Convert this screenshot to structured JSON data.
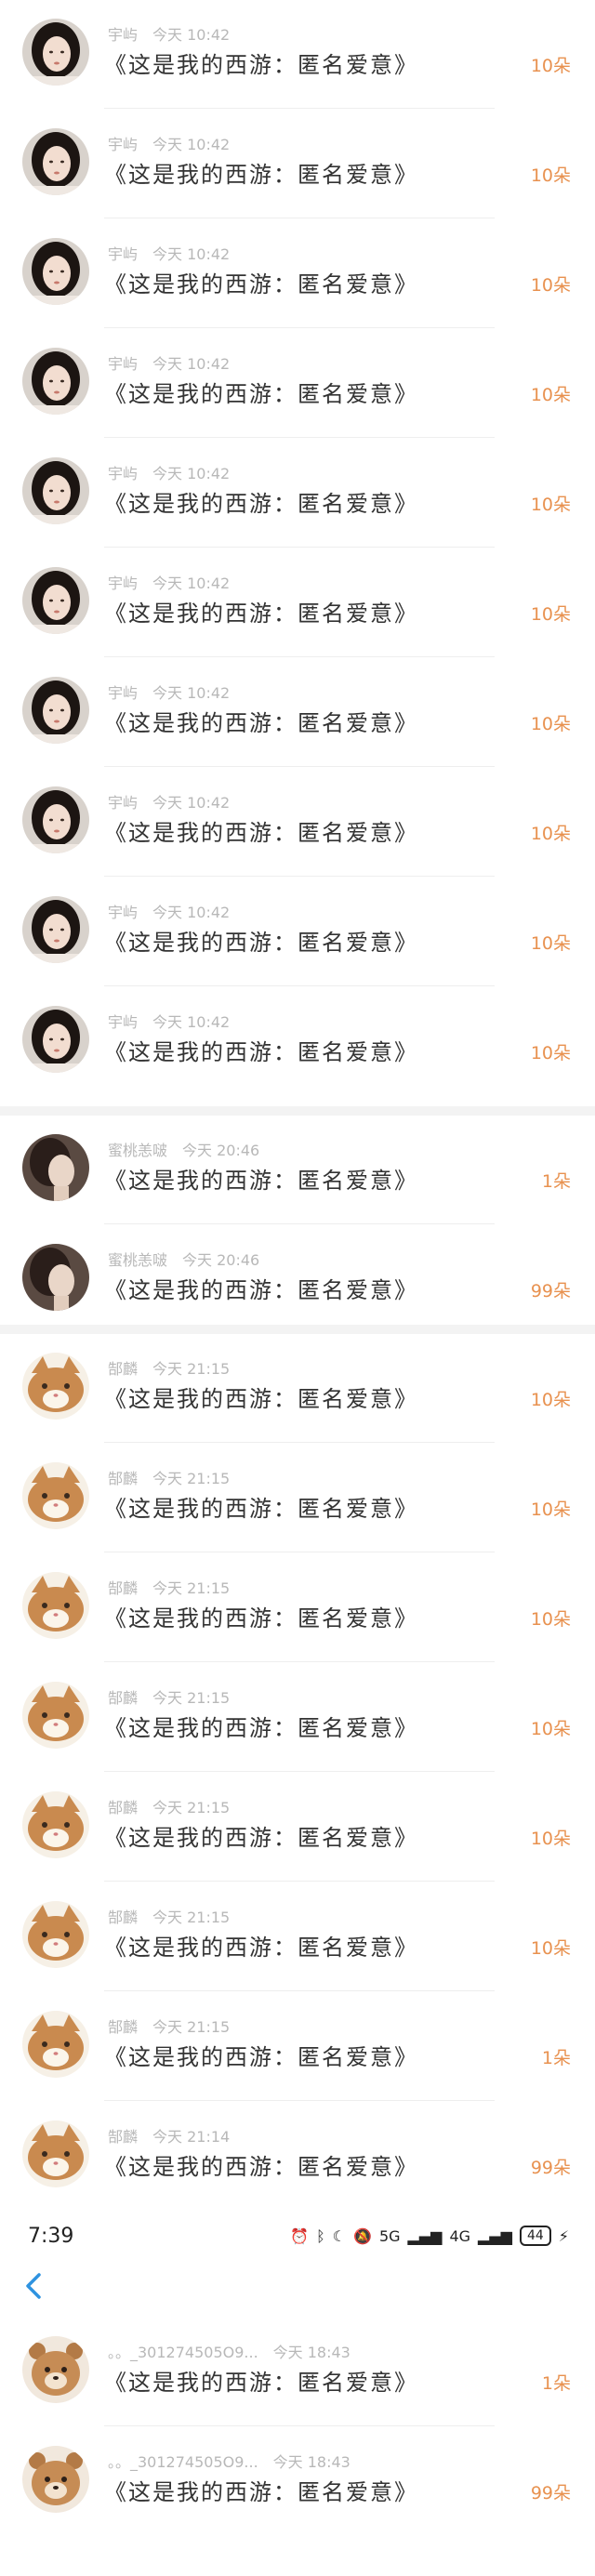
{
  "records": [
    {
      "user": "宇屿",
      "time": "今天 10:42",
      "title": "《这是我的西游：匿名爱意》",
      "count": "10朵",
      "avatar": "girl-avatar"
    },
    {
      "user": "宇屿",
      "time": "今天 10:42",
      "title": "《这是我的西游：匿名爱意》",
      "count": "10朵",
      "avatar": "girl-avatar"
    },
    {
      "user": "宇屿",
      "time": "今天 10:42",
      "title": "《这是我的西游：匿名爱意》",
      "count": "10朵",
      "avatar": "girl-avatar"
    },
    {
      "user": "宇屿",
      "time": "今天 10:42",
      "title": "《这是我的西游：匿名爱意》",
      "count": "10朵",
      "avatar": "girl-avatar"
    },
    {
      "user": "宇屿",
      "time": "今天 10:42",
      "title": "《这是我的西游：匿名爱意》",
      "count": "10朵",
      "avatar": "girl-avatar"
    },
    {
      "user": "宇屿",
      "time": "今天 10:42",
      "title": "《这是我的西游：匿名爱意》",
      "count": "10朵",
      "avatar": "girl-avatar"
    },
    {
      "user": "宇屿",
      "time": "今天 10:42",
      "title": "《这是我的西游：匿名爱意》",
      "count": "10朵",
      "avatar": "girl-avatar"
    },
    {
      "user": "宇屿",
      "time": "今天 10:42",
      "title": "《这是我的西游：匿名爱意》",
      "count": "10朵",
      "avatar": "girl-avatar"
    },
    {
      "user": "宇屿",
      "time": "今天 10:42",
      "title": "《这是我的西游：匿名爱意》",
      "count": "10朵",
      "avatar": "girl-avatar"
    },
    {
      "user": "宇屿",
      "time": "今天 10:42",
      "title": "《这是我的西游：匿名爱意》",
      "count": "10朵",
      "avatar": "girl-avatar"
    },
    {
      "user": "蜜桃恙啵",
      "time": "今天 20:46",
      "title": "《这是我的西游：匿名爱意》",
      "count": "1朵",
      "avatar": "side-profile-avatar"
    },
    {
      "user": "蜜桃恙啵",
      "time": "今天 20:46",
      "title": "《这是我的西游：匿名爱意》",
      "count": "99朵",
      "avatar": "side-profile-avatar"
    },
    {
      "user": "郜麟",
      "time": "今天 21:15",
      "title": "《这是我的西游：匿名爱意》",
      "count": "10朵",
      "avatar": "cat-avatar"
    },
    {
      "user": "郜麟",
      "time": "今天 21:15",
      "title": "《这是我的西游：匿名爱意》",
      "count": "10朵",
      "avatar": "cat-avatar"
    },
    {
      "user": "郜麟",
      "time": "今天 21:15",
      "title": "《这是我的西游：匿名爱意》",
      "count": "10朵",
      "avatar": "cat-avatar"
    },
    {
      "user": "郜麟",
      "time": "今天 21:15",
      "title": "《这是我的西游：匿名爱意》",
      "count": "10朵",
      "avatar": "cat-avatar"
    },
    {
      "user": "郜麟",
      "time": "今天 21:15",
      "title": "《这是我的西游：匿名爱意》",
      "count": "10朵",
      "avatar": "cat-avatar"
    },
    {
      "user": "郜麟",
      "time": "今天 21:15",
      "title": "《这是我的西游：匿名爱意》",
      "count": "10朵",
      "avatar": "cat-avatar"
    },
    {
      "user": "郜麟",
      "time": "今天 21:15",
      "title": "《这是我的西游：匿名爱意》",
      "count": "1朵",
      "avatar": "cat-avatar"
    },
    {
      "user": "郜麟",
      "time": "今天 21:14",
      "title": "《这是我的西游：匿名爱意》",
      "count": "99朵",
      "avatar": "cat-avatar"
    }
  ],
  "status_bar": {
    "time": "7:39",
    "network": "5G",
    "network2": "4G",
    "battery": "44"
  },
  "nav": {
    "back_icon": "chevron-left-icon"
  },
  "records2": [
    {
      "user": "。。_301274505О9...",
      "time": "今天 18:43",
      "title": "《这是我的西游：匿名爱意》",
      "count": "1朵",
      "avatar": "bear-avatar"
    },
    {
      "user": "。。_301274505О9...",
      "time": "今天 18:43",
      "title": "《这是我的西游：匿名爱意》",
      "count": "99朵",
      "avatar": "bear-avatar"
    }
  ],
  "colors": {
    "accent": "#e8914f",
    "meta": "#b8b8b8",
    "title": "#333333",
    "back": "#2f93e0"
  }
}
